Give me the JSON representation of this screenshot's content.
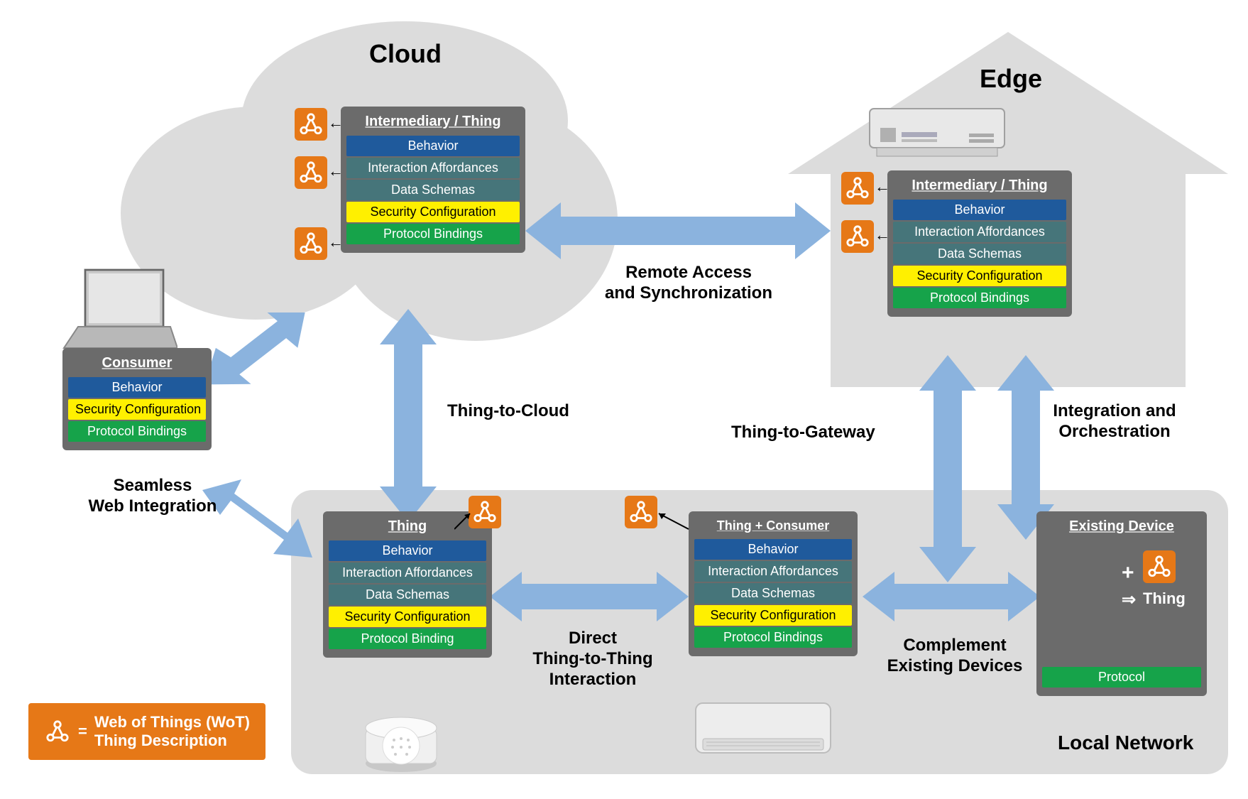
{
  "zones": {
    "cloud": "Cloud",
    "edge": "Edge",
    "local": "Local Network"
  },
  "cards": {
    "cloud_intermediary": {
      "title": "Intermediary / Thing",
      "rows": [
        "Behavior",
        "Interaction Affordances",
        "Data Schemas",
        "Security Configuration",
        "Protocol Bindings"
      ]
    },
    "edge_intermediary": {
      "title": "Intermediary / Thing",
      "rows": [
        "Behavior",
        "Interaction Affordances",
        "Data Schemas",
        "Security Configuration",
        "Protocol Bindings"
      ]
    },
    "consumer": {
      "title": "Consumer",
      "rows": [
        "Behavior",
        "Security Configuration",
        "Protocol Bindings"
      ]
    },
    "thing": {
      "title": "Thing",
      "rows": [
        "Behavior",
        "Interaction Affordances",
        "Data Schemas",
        "Security Configuration",
        "Protocol Binding"
      ]
    },
    "thing_consumer": {
      "title": "Thing + Consumer",
      "rows": [
        "Behavior",
        "Interaction Affordances",
        "Data Schemas",
        "Security Configuration",
        "Protocol Bindings"
      ]
    },
    "existing_device": {
      "title": "Existing Device",
      "plus_label": "+",
      "arrow_label": "⇒",
      "thing_label": "Thing",
      "protocol": "Protocol"
    }
  },
  "annotations": {
    "remote_access": "Remote Access\nand Synchronization",
    "thing_to_cloud": "Thing-to-Cloud",
    "thing_to_gateway": "Thing-to-Gateway",
    "integration": "Integration and\nOrchestration",
    "seamless": "Seamless\nWeb Integration",
    "direct": "Direct\nThing-to-Thing\nInteraction",
    "complement": "Complement\nExisting Devices"
  },
  "legend": {
    "equals": "=",
    "line1": "Web of Things (WoT)",
    "line2": "Thing Description"
  },
  "icons": {
    "wot": "wot-icon",
    "laptop": "laptop-icon",
    "router": "router-icon",
    "sensor": "sensor-icon",
    "ac_unit": "ac-unit-icon",
    "bulb": "bulb-icon"
  },
  "colors": {
    "region": "#dcdcdc",
    "card": "#6b6b6b",
    "blue": "#1f5a9c",
    "teal": "#46757a",
    "yellow": "#fff000",
    "green": "#16a34a",
    "orange": "#e67817",
    "arrow": "#8bb3de"
  }
}
